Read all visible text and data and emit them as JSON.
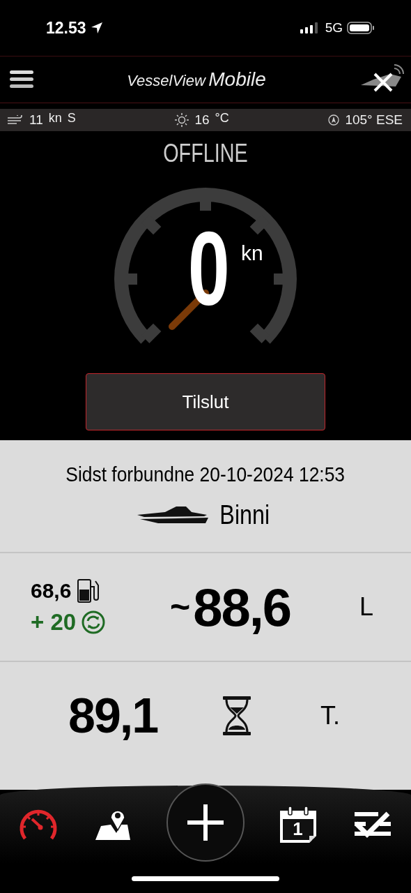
{
  "status_bar": {
    "time": "12.53",
    "network": "5G"
  },
  "header": {
    "title_light": "VesselView",
    "title_bold": "Mobile"
  },
  "weather": {
    "wind": "11",
    "wind_unit": "kn",
    "wind_dir": "S",
    "temperature": "16",
    "temp_unit": "°C",
    "heading": "105° ESE"
  },
  "gauge": {
    "status": "OFFLINE",
    "speed": "0",
    "unit": "kn"
  },
  "connect_button": "Tilslut",
  "last_connected": "Sidst forbundne 20-10-2024 12:53",
  "vessel_name": "Binni",
  "fuel": {
    "tank": "68,6",
    "added": "+ 20",
    "estimate_prefix": "~",
    "estimate": "88,6",
    "unit": "L"
  },
  "hours": {
    "value": "89,1",
    "unit": "T."
  },
  "nav": [
    {
      "kind": "gauge",
      "selected": true
    },
    {
      "kind": "map",
      "selected": false
    },
    {
      "kind": "add",
      "selected": false
    },
    {
      "kind": "calendar",
      "selected": false,
      "day": "1"
    },
    {
      "kind": "checklist",
      "selected": false
    }
  ]
}
